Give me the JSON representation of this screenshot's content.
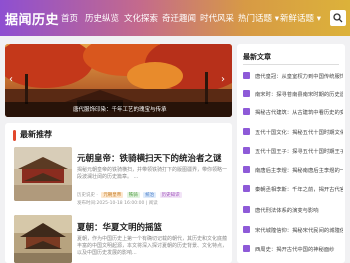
{
  "header": {
    "logo": "据闻历史",
    "nav": [
      "首页",
      "历史纵览",
      "文化探索",
      "奇迁趣闻",
      "时代风采",
      "热门话题 ▾",
      "新鲜话题 ▾"
    ]
  },
  "slider": {
    "caption": "唐代服饰印染：千年工艺的瑰宝与传承"
  },
  "section": {
    "title": "最新推荐",
    "articles": [
      {
        "title": "元朝皇帝：铁骑横扫天下的统治者之谜",
        "excerpt": "揭秘元朝皇帝的铁骑横扫，并带领铁骑打下的版图疆界，带你领略一段波澜壮阔的历史篇章。 ...",
        "author": "历史说史 ·",
        "date": "发布时间:2025-10-18 16:00:00 | 阅读",
        "tags": [
          "元朝皇帝",
          "铁骑",
          "统治",
          "历史知识"
        ]
      },
      {
        "title": "夏朝：华夏文明的摇篮",
        "excerpt": "夏朝，作为中国历史上第一个有确切记载的朝代，其历史和文化底蕴丰富的中国文明起源，本文将深入探讨夏朝的历史背景、文化特点，以及中国历史发展的影响..."
      }
    ]
  },
  "sidebar": {
    "title": "最新文章",
    "items": [
      "唐代皇冠：从皇室权力到中国传统服饰",
      "南宋时：探寻苍南县南宋时期的历史遗迹",
      "揭秘古代建筑：从古建筑中看历史的变迁",
      "五代十国文化：揭秘五代十国时期文化的繁荣",
      "五代十国王子：探寻五代十国时期王子的命运",
      "南唐后主李煜：揭秘南唐后主李煜的一生",
      "秦朝丞相李斯：千年之前，揭开古代官制变迁",
      "唐代刑法体系的演变与影响",
      "宋代城隍信仰：揭秘宋代民间的城隍信仰",
      "西周史：揭开古代中国的神秘面纱"
    ]
  },
  "colors": {
    "accent": "#e2482d",
    "sidebar_icon": "#8e5ad8"
  }
}
